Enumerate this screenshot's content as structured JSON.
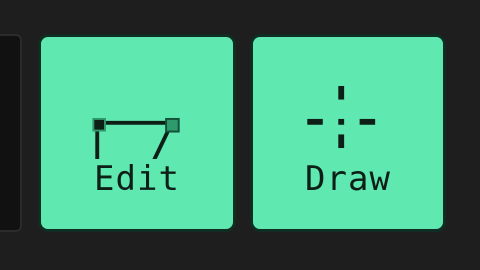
{
  "toolbar": {
    "edit": {
      "label": "Edit",
      "icon": "edit-polygon-icon"
    },
    "draw": {
      "label": "Draw",
      "icon": "crosshair-icon"
    }
  },
  "colors": {
    "background": "#1e1e1e",
    "button_fill": "#5fe8b0",
    "button_border": "#0f2d22",
    "icon_ink": "#0d1f17",
    "selected_vertex": "#2f9a6c"
  }
}
